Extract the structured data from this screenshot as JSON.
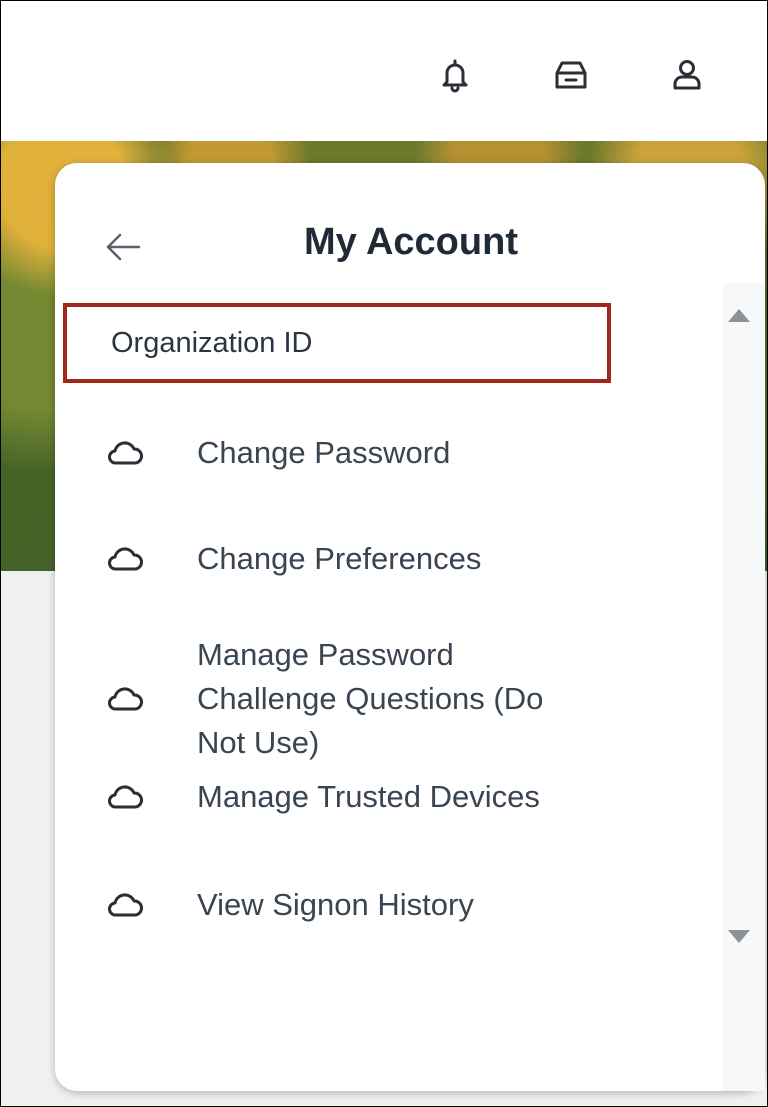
{
  "header": {
    "icons": [
      "bell-icon",
      "inbox-icon",
      "profile-icon"
    ]
  },
  "panel": {
    "title": "My Account",
    "back_icon": "arrow-left-icon",
    "section_label": "Organization ID",
    "highlight_color": "#a2271b",
    "items": [
      {
        "label": "Change Password",
        "icon": "cloud-icon"
      },
      {
        "label": "Change Preferences",
        "icon": "cloud-icon"
      },
      {
        "label": "Manage Password Challenge Questions (Do Not Use)",
        "icon": "cloud-icon"
      },
      {
        "label": "Manage Trusted Devices",
        "icon": "cloud-icon"
      },
      {
        "label": "View Signon History",
        "icon": "cloud-icon"
      }
    ]
  }
}
